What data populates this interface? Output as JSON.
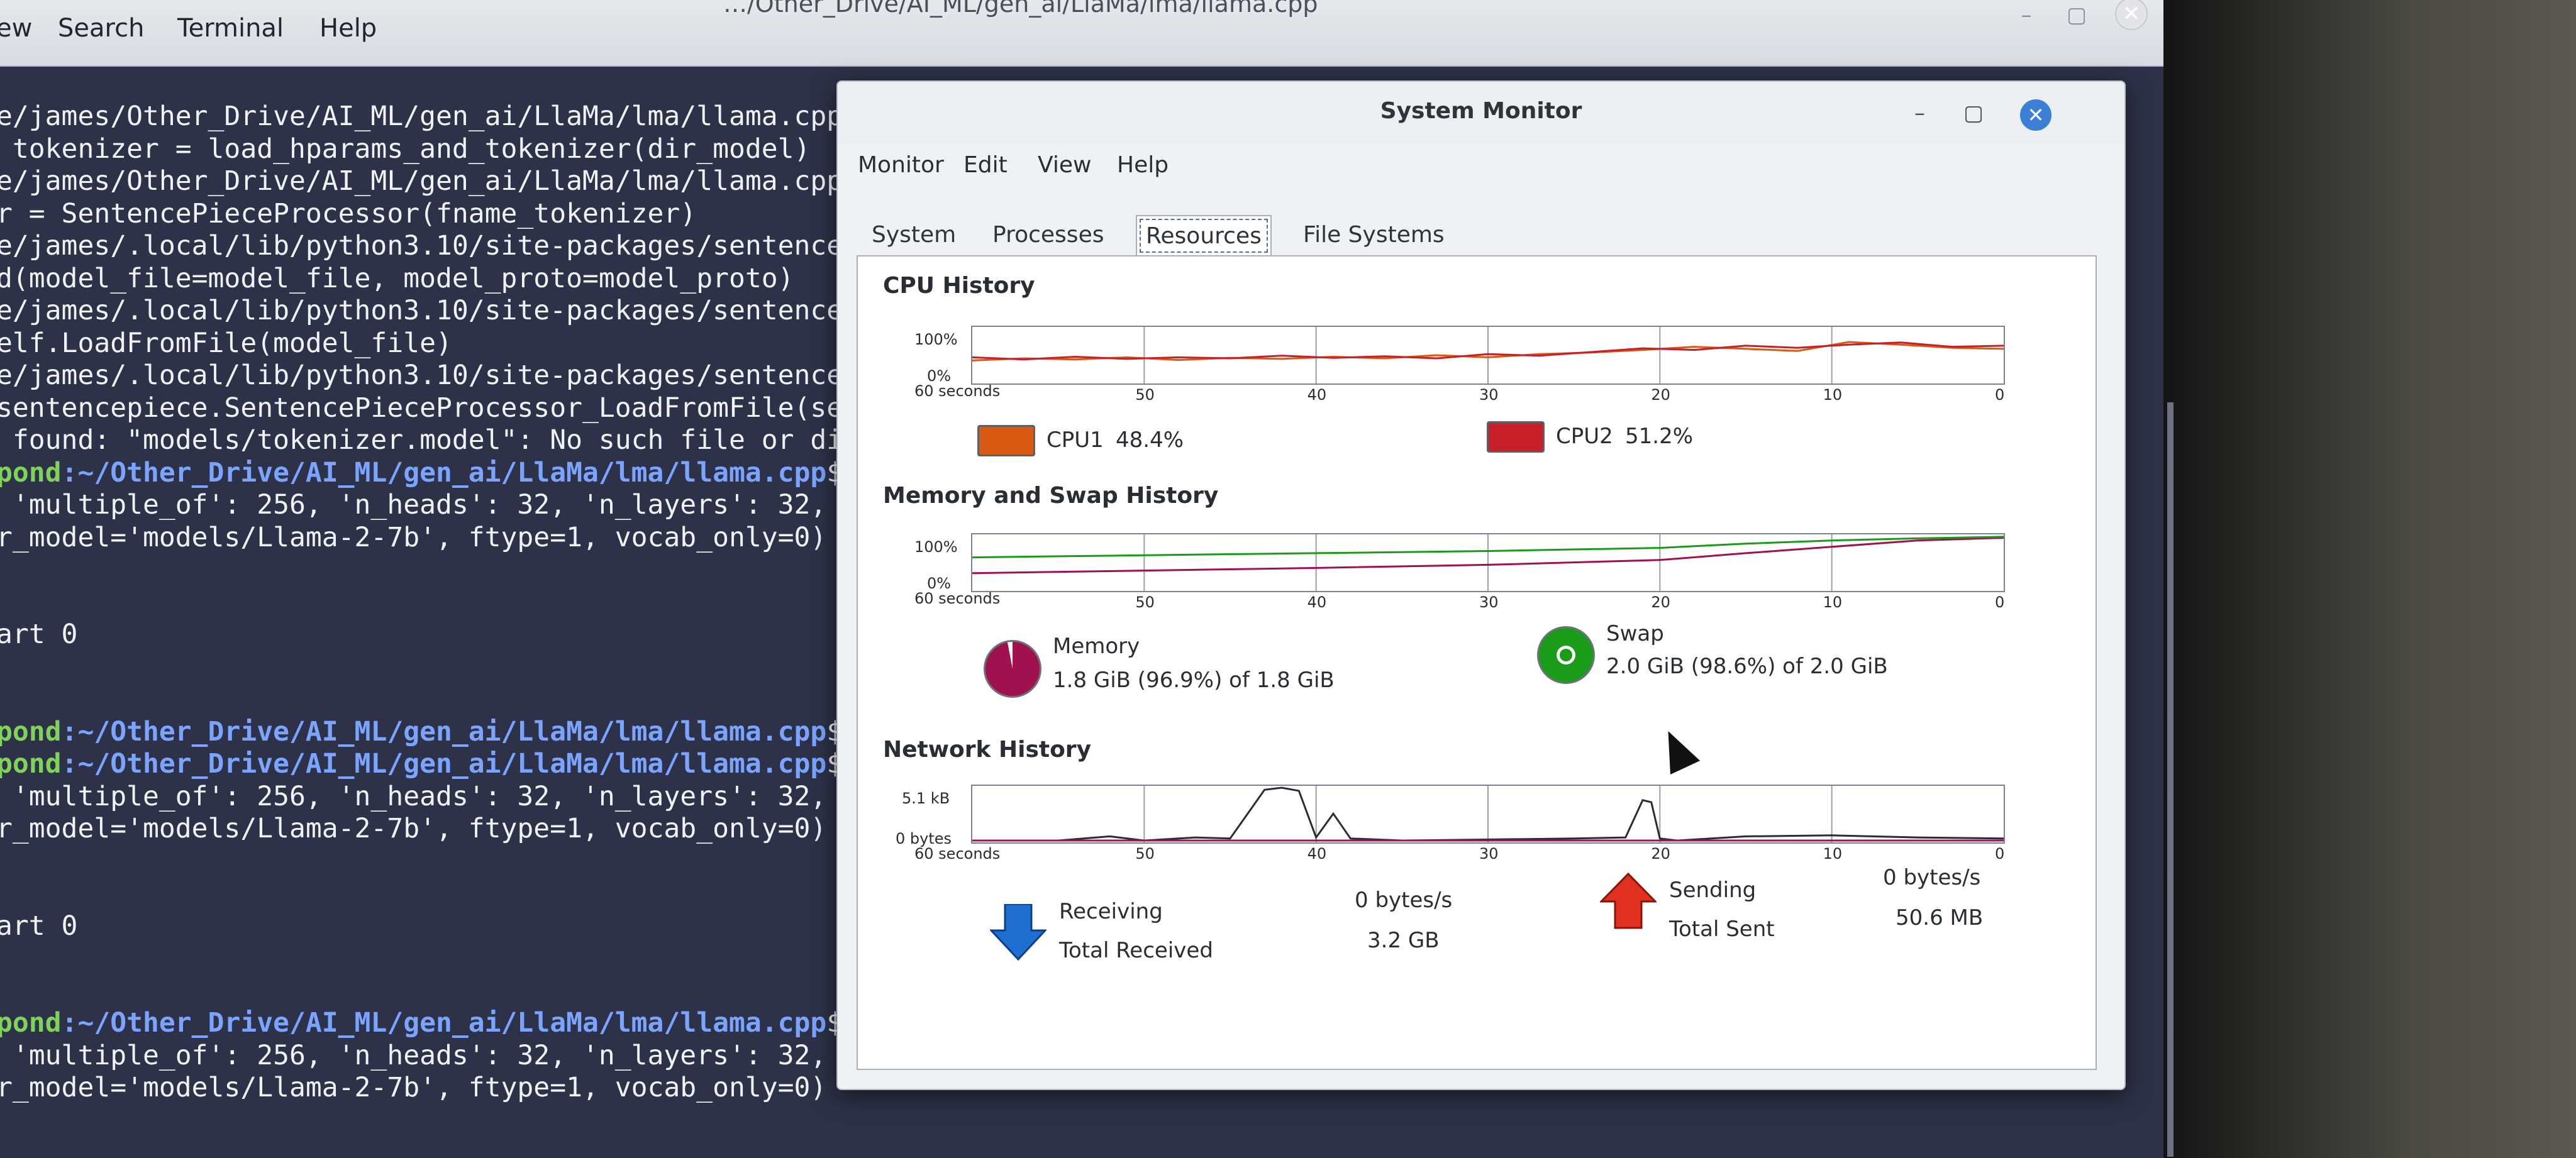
{
  "terminal": {
    "title": "…/Other_Drive/AI_ML/gen_ai/LlaMa/lma/llama.cpp",
    "menu": [
      "ew",
      "Search",
      "Terminal",
      "Help"
    ],
    "lines": [
      {
        "text": "e/james/Other_Drive/AI_ML/gen_ai/LlaMa/lma/llama.cpp"
      },
      {
        "text": " tokenizer = load_hparams_and_tokenizer(dir_model)"
      },
      {
        "text": "e/james/Other_Drive/AI_ML/gen_ai/LlaMa/lma/llama.cpp"
      },
      {
        "text": "r = SentencePieceProcessor(fname_tokenizer)"
      },
      {
        "text": "e/james/.local/lib/python3.10/site-packages/sentence"
      },
      {
        "text": "d(model_file=model_file, model_proto=model_proto)"
      },
      {
        "text": "e/james/.local/lib/python3.10/site-packages/sentence"
      },
      {
        "text": "elf.LoadFromFile(model_file)"
      },
      {
        "text": "e/james/.local/lib/python3.10/site-packages/sentence"
      },
      {
        "text": "sentencepiece.SentencePieceProcessor_LoadFromFile(se"
      },
      {
        "text": " found: \"models/tokenizer.model\": No such file or di"
      },
      {
        "host": "pond",
        "path": ":~/Other_Drive/AI_ML/gen_ai/LlaMa/lma/llama.cpp",
        "text": "$"
      },
      {
        "text": " 'multiple_of': 256, 'n_heads': 32, 'n_layers': 32,"
      },
      {
        "text": "r_model='models/Llama-2-7b', ftype=1, vocab_only=0)"
      },
      {
        "text": ""
      },
      {
        "text": ""
      },
      {
        "text": "art 0"
      },
      {
        "text": ""
      },
      {
        "text": ""
      },
      {
        "host": "pond",
        "path": ":~/Other_Drive/AI_ML/gen_ai/LlaMa/lma/llama.cpp",
        "text": "$"
      },
      {
        "host": "pond",
        "path": ":~/Other_Drive/AI_ML/gen_ai/LlaMa/lma/llama.cpp",
        "text": "$"
      },
      {
        "text": " 'multiple_of': 256, 'n_heads': 32, 'n_layers': 32,"
      },
      {
        "text": "r_model='models/Llama-2-7b', ftype=1, vocab_only=0)"
      },
      {
        "text": ""
      },
      {
        "text": ""
      },
      {
        "text": "art 0"
      },
      {
        "text": ""
      },
      {
        "text": ""
      },
      {
        "host": "pond",
        "path": ":~/Other_Drive/AI_ML/gen_ai/LlaMa/lma/llama.cpp",
        "text": "$"
      },
      {
        "text": " 'multiple_of': 256, 'n_heads': 32, 'n_layers': 32,"
      },
      {
        "text": "r_model='models/Llama-2-7b', ftype=1, vocab_only=0)"
      }
    ]
  },
  "sysmon": {
    "title": "System Monitor",
    "menu": [
      "Monitor",
      "Edit",
      "View",
      "Help"
    ],
    "tabs": [
      "System",
      "Processes",
      "Resources",
      "File Systems"
    ],
    "active_tab": "Resources",
    "cpu": {
      "title": "CPU History",
      "ymax_label": "100%",
      "ymin_label": "0%",
      "xstart_label": "60 seconds",
      "ticks": [
        "50",
        "40",
        "30",
        "20",
        "10",
        "0"
      ],
      "legend": [
        {
          "name": "CPU1",
          "value": "48.4%",
          "color": "#d85a12"
        },
        {
          "name": "CPU2",
          "value": "51.2%",
          "color": "#c8202b"
        }
      ]
    },
    "memory": {
      "title": "Memory and Swap History",
      "ymax_label": "100%",
      "ymin_label": "0%",
      "xstart_label": "60 seconds",
      "ticks": [
        "50",
        "40",
        "30",
        "20",
        "10",
        "0"
      ],
      "mem_label": "Memory",
      "mem_value": "1.8 GiB (96.9%) of 1.8 GiB",
      "mem_color": "#a0124f",
      "swap_label": "Swap",
      "swap_value": "2.0 GiB (98.6%) of 2.0 GiB",
      "swap_color": "#1a9b1a"
    },
    "network": {
      "title": "Network History",
      "ymax_label": "5.1 kB",
      "ymin_label": "0 bytes",
      "xstart_label": "60 seconds",
      "ticks": [
        "50",
        "40",
        "30",
        "20",
        "10",
        "0"
      ],
      "receiving_label": "Receiving",
      "receiving_value": "0 bytes/s",
      "total_received_label": "Total Received",
      "total_received_value": "3.2 GB",
      "sending_label": "Sending",
      "sending_value": "0 bytes/s",
      "total_sent_label": "Total Sent",
      "total_sent_value": "50.6 MB"
    }
  },
  "chart_data": [
    {
      "type": "line",
      "title": "CPU History",
      "x": [
        60,
        57,
        54,
        51,
        48,
        45,
        42,
        39,
        36,
        33,
        30,
        27,
        24,
        21,
        18,
        15,
        12,
        9,
        6,
        3,
        0
      ],
      "series": [
        {
          "name": "CPU1",
          "values": [
            40,
            44,
            42,
            46,
            41,
            45,
            43,
            47,
            44,
            50,
            46,
            52,
            55,
            60,
            66,
            62,
            58,
            75,
            70,
            64,
            62
          ]
        },
        {
          "name": "CPU2",
          "values": [
            46,
            42,
            47,
            43,
            46,
            44,
            49,
            45,
            48,
            44,
            52,
            49,
            56,
            63,
            60,
            68,
            64,
            70,
            74,
            66,
            68
          ]
        }
      ],
      "ylim": [
        0,
        100
      ]
    },
    {
      "type": "line",
      "title": "Memory and Swap History",
      "x": [
        60,
        50,
        40,
        30,
        20,
        15,
        10,
        5,
        0
      ],
      "series": [
        {
          "name": "Memory",
          "values": [
            30,
            35,
            40,
            46,
            55,
            68,
            80,
            92,
            97
          ]
        },
        {
          "name": "Swap",
          "values": [
            60,
            64,
            68,
            72,
            78,
            86,
            92,
            96,
            99
          ]
        }
      ],
      "ylim": [
        0,
        100
      ]
    },
    {
      "type": "line",
      "title": "Network History",
      "x": [
        60,
        55,
        52,
        50,
        47,
        45,
        43,
        42,
        41,
        40,
        39,
        38,
        35,
        30,
        25,
        22,
        21,
        20.5,
        20,
        19,
        15,
        10,
        5,
        0
      ],
      "series": [
        {
          "name": "Receiving",
          "values": [
            0,
            0,
            0.4,
            0,
            0.3,
            0.2,
            4.9,
            5.1,
            4.8,
            0.3,
            2.6,
            0.2,
            0,
            0.1,
            0.2,
            0.3,
            3.9,
            3.7,
            0.2,
            0,
            0.4,
            0.5,
            0.3,
            0.2
          ]
        },
        {
          "name": "Sending",
          "values": [
            0,
            0,
            0,
            0,
            0,
            0,
            0,
            0,
            0,
            0,
            0,
            0,
            0,
            0,
            0,
            0,
            0,
            0,
            0,
            0,
            0,
            0,
            0,
            0
          ]
        }
      ],
      "ylim": [
        0,
        5.1
      ]
    }
  ]
}
